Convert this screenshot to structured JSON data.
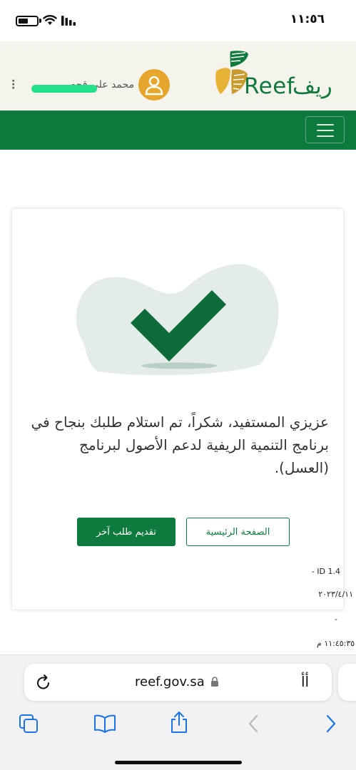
{
  "status_bar": {
    "time": "١١:٥٦",
    "battery_level": 0.55
  },
  "header": {
    "logo_text": "Reef",
    "logo_text_ar": "ريف",
    "user_name": "محمد علي قحطاني",
    "brand_color": "#0e7a3d",
    "avatar_color": "#e6a52b"
  },
  "nav": {
    "menu_icon": "hamburger-icon"
  },
  "confirmation": {
    "illustration_icon": "check-icon",
    "message": "عزيزي المستفيد، شكراً، تم استلام طلبك بنجاح في برنامج التنمية الريفية لدعم الأصول لبرنامج (العسل).",
    "home_button": "الصفحة الرئيسية",
    "new_request_button": "تقديم طلب آخر",
    "id_label": "- ID 1.4",
    "date": "٢٠٢٣/٤/١١",
    "dash": "-",
    "time": "١١:٤٥:٣٥ م"
  },
  "browser": {
    "url": "reef.gov.sa",
    "text_size_button": "ꜿꜿ",
    "aa_label": "ﺃﺃ"
  }
}
